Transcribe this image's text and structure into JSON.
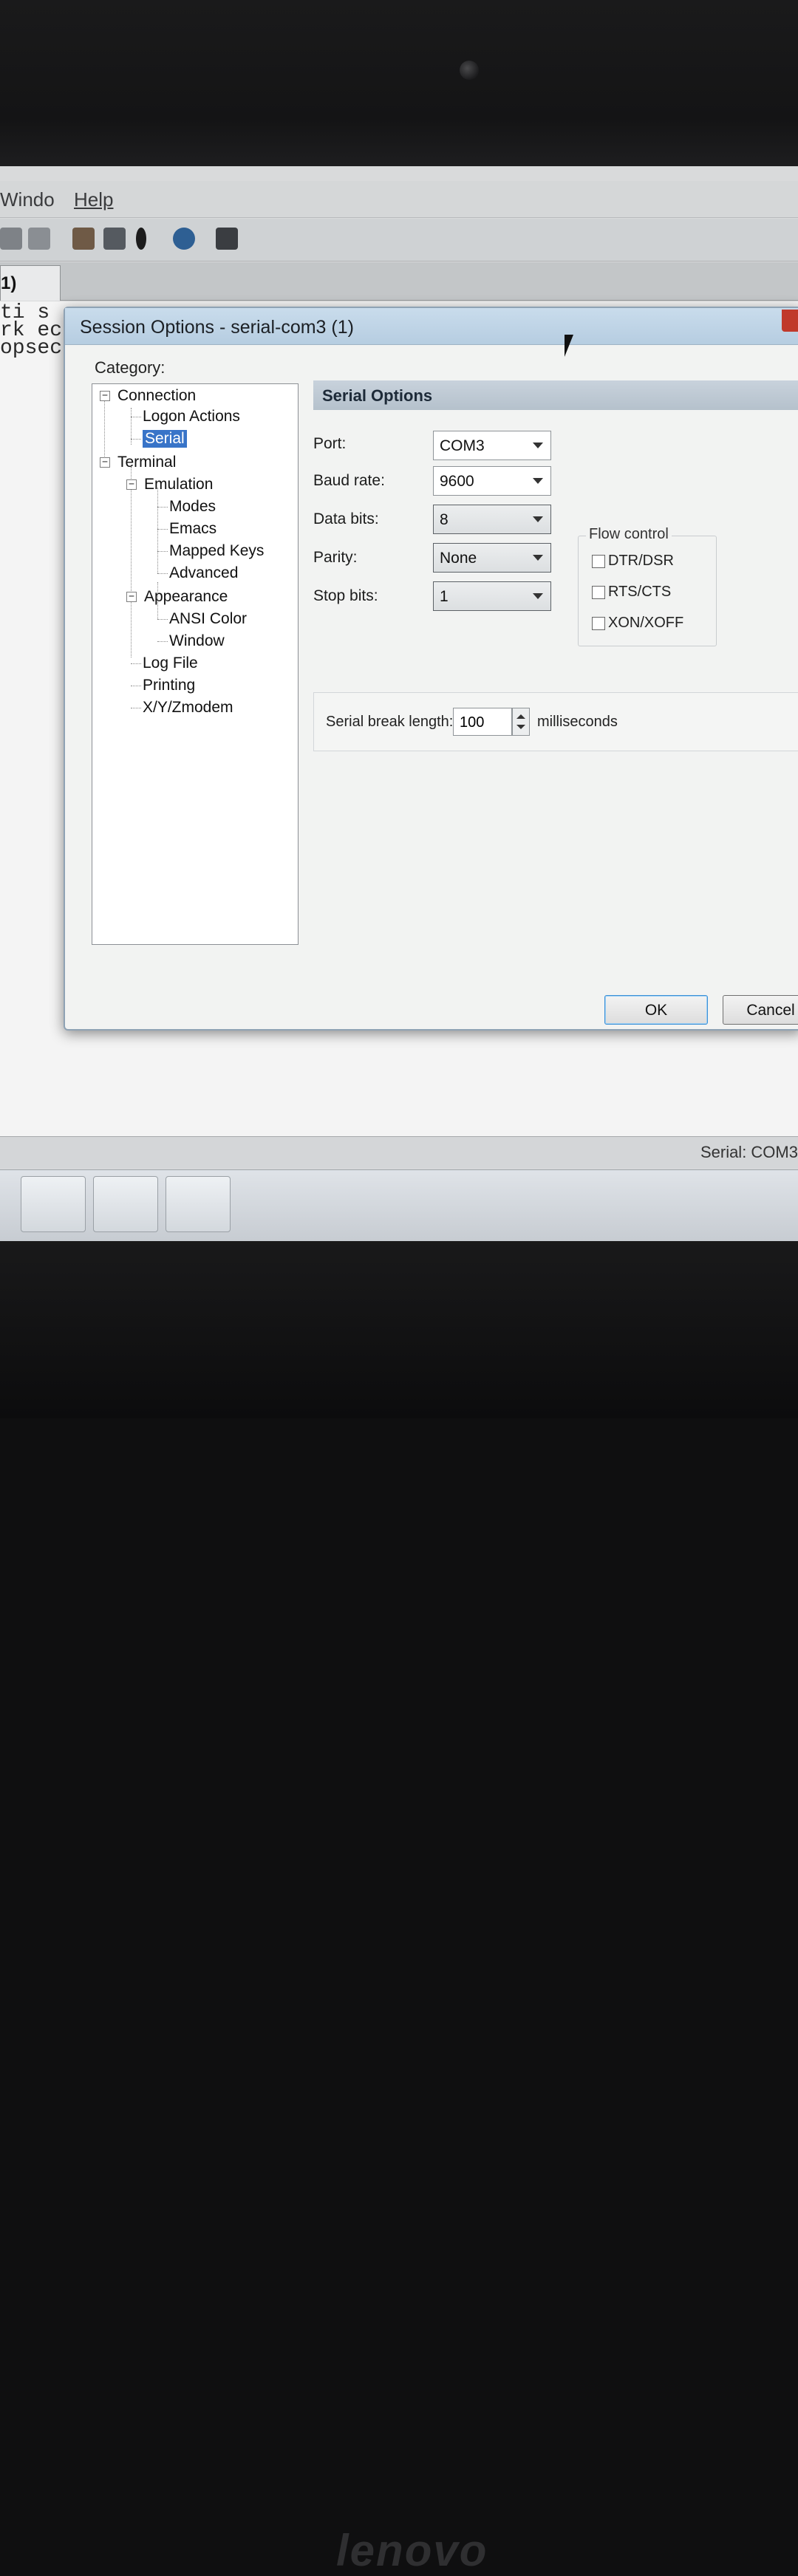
{
  "menubar": {
    "window_label": "Windo",
    "help_label": "Help"
  },
  "tab": {
    "label": "1)"
  },
  "terminal": {
    "lines": [
      "ti s",
      "rk ec",
      "opsec."
    ]
  },
  "dialog": {
    "title": "Session Options - serial-com3 (1)",
    "category_label": "Category:",
    "tree": [
      {
        "label": "Connection"
      },
      {
        "label": "Logon Actions"
      },
      {
        "label": "Serial"
      },
      {
        "label": "Terminal"
      },
      {
        "label": "Emulation"
      },
      {
        "label": "Modes"
      },
      {
        "label": "Emacs"
      },
      {
        "label": "Mapped Keys"
      },
      {
        "label": "Advanced"
      },
      {
        "label": "Appearance"
      },
      {
        "label": "ANSI Color"
      },
      {
        "label": "Window"
      },
      {
        "label": "Log File"
      },
      {
        "label": "Printing"
      },
      {
        "label": "X/Y/Zmodem"
      }
    ],
    "section_title": "Serial Options",
    "fields": {
      "port": {
        "label": "Port:",
        "value": "COM3"
      },
      "baud": {
        "label": "Baud rate:",
        "value": "9600"
      },
      "data_bits": {
        "label": "Data bits:",
        "value": "8"
      },
      "parity": {
        "label": "Parity:",
        "value": "None"
      },
      "stop_bits": {
        "label": "Stop bits:",
        "value": "1"
      }
    },
    "flow_control": {
      "title": "Flow control",
      "options": [
        {
          "label": "DTR/DSR",
          "checked": false
        },
        {
          "label": "RTS/CTS",
          "checked": false
        },
        {
          "label": "XON/XOFF",
          "checked": false
        }
      ]
    },
    "serial_break": {
      "label": "Serial break length:",
      "value": "100",
      "unit": "milliseconds"
    },
    "buttons": {
      "ok": "OK",
      "cancel": "Cancel"
    }
  },
  "statusbar": {
    "text": "Serial: COM3"
  },
  "bezel": {
    "brand": "lenovo"
  }
}
